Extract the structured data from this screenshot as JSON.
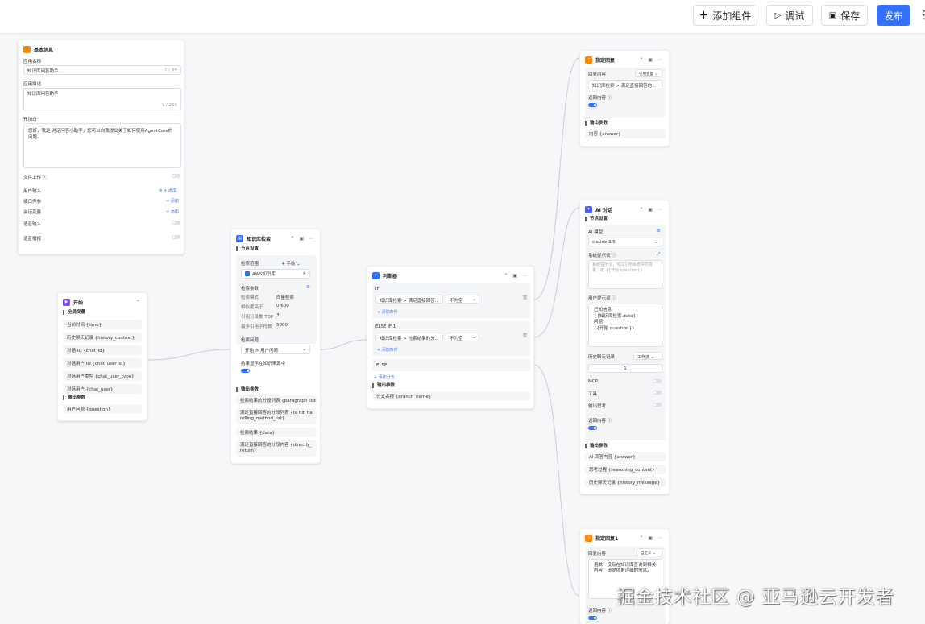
{
  "toolbar": {
    "add_component": "添加组件",
    "debug": "调试",
    "save": "保存",
    "publish": "发布"
  },
  "basic": {
    "title": "基本信息",
    "app_name_label": "应用名称",
    "app_name_value": "知识库问答助手",
    "app_name_count": "7 / 64",
    "desc_label": "应用描述",
    "desc_value": "知识库问答助手",
    "desc_count": "7 / 256",
    "opening_label": "开场白",
    "opening_value": "您好，我是 对话问答小助手，您可以向我提出关于如何使用AgentCore的问题。",
    "file_upload": "文件上传",
    "user_input": "用户输入",
    "interface_params": "接口传参",
    "session_vars": "会话变量",
    "voice_input": "语音输入",
    "voice_play": "语音播报",
    "add": "添加"
  },
  "start": {
    "title": "开始",
    "globals_label": "全局变量",
    "globals": [
      "当前时间 {time}",
      "历史聊天记录 {history_context}",
      "对话 ID {chat_id}",
      "对话用户 ID {chat_user_id}",
      "对话用户类型 {chat_user_type}",
      "对话用户 {chat_user}"
    ],
    "output_label": "输出参数",
    "outputs": [
      "用户问题 {question}"
    ]
  },
  "kb": {
    "title": "知识库检索",
    "settings": "节点设置",
    "scope_label": "检索范围",
    "scope_mode": "手动",
    "kb_name": "AWS知识库",
    "params_label": "检索参数",
    "params": [
      {
        "k": "检索模式",
        "v": "向量检索"
      },
      {
        "k": "相似度高于",
        "v": "0.600"
      },
      {
        "k": "引用分段数 TOP",
        "v": "3"
      },
      {
        "k": "最多引用字符数",
        "v": "5000"
      }
    ],
    "question_label": "检索问题",
    "question_value": "开始 > 用户问题",
    "show_source": "结果显示在知识来源中",
    "output_label": "输出参数",
    "outputs": [
      "检索结果的分段列表 {paragraph_list}",
      "满足直接回答的分段列表 {is_hit_handling_method_list}",
      "检索结果 {data}",
      "满足直接回答的分段内容 {directly_return}"
    ]
  },
  "cond": {
    "title": "判断器",
    "if_label": "IF",
    "if_field": "知识库检索 > 满足直接回答...",
    "if_op": "不为空",
    "elif_label": "ELSE IF 1",
    "elif_field": "知识库检索 > 检索结果的分...",
    "elif_op": "不为空",
    "add_cond": "添加条件",
    "else_label": "ELSE",
    "add_branch": "添加分支",
    "output_label": "输出参数",
    "outputs": [
      "分支名称 {branch_name}"
    ]
  },
  "reply": {
    "title": "指定回复",
    "content_label": "回复内容",
    "mode": "引用变量",
    "content": "知识库检索 > 满足直接回答的...",
    "return_label": "返回内容",
    "output_label": "输出参数",
    "outputs": [
      "内容 {answer}"
    ]
  },
  "ai": {
    "title": "AI 对话",
    "settings": "节点设置",
    "model_label": "AI 模型",
    "model": "claude 3.5",
    "sys_label": "系统提示词",
    "sys_placeholder": "系统提示词，可以引用系统中的变量：如 {{开始.question}}",
    "user_label": "用户提示词",
    "user_prompt": [
      "已知信息:",
      "{{知识库检索.data}}",
      "问题:",
      "{{开始.question}}"
    ],
    "history_label": "历史聊天记录",
    "history_mode": "工作流",
    "history_count": "1",
    "mcp": "MCP",
    "tools": "工具",
    "think": "输出思考",
    "return_label": "返回内容",
    "output_label": "输出参数",
    "outputs": [
      "AI 回答内容 {answer}",
      "思考过程 {reasoning_content}",
      "历史聊天记录 {history_message}"
    ]
  },
  "reply1": {
    "title": "指定回复1",
    "content_label": "回复内容",
    "mode": "自定义",
    "content": "抱歉，没有在知识库查询到相关内容，请提供更详细的信息。",
    "return_label": "返回内容"
  },
  "watermark": "掘金技术社区 @ 亚马逊云开发者",
  "colors": {
    "accent": "#3370ff",
    "start_icon": "#7b4ff0",
    "kb_icon": "#3370ff",
    "cond_icon": "#3370ff",
    "reply_icon": "#ff8800",
    "ai_icon": "#4e5ef0"
  }
}
